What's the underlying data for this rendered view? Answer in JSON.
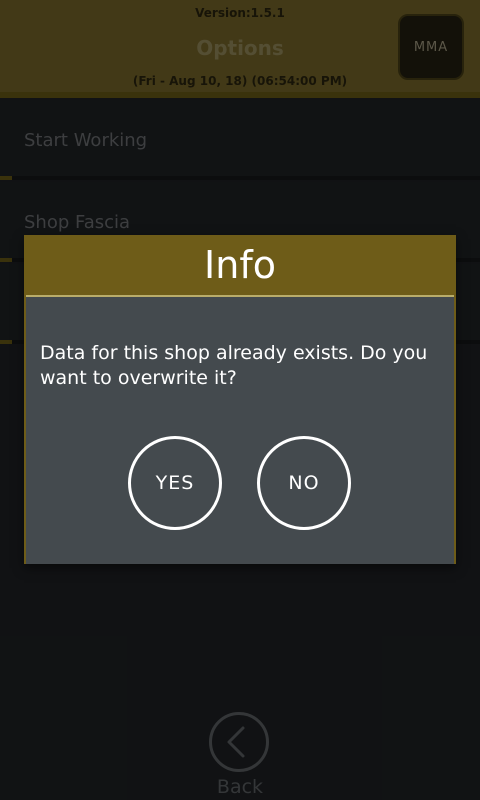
{
  "header": {
    "version": "Version:1.5.1",
    "title": "Options",
    "datetime": "(Fri - Aug 10, 18) (06:54:00 PM)",
    "logo_text": "MMA"
  },
  "menu": {
    "items": [
      {
        "label": "Start Working"
      },
      {
        "label": "Shop Fascia"
      }
    ]
  },
  "dialog": {
    "title": "Info",
    "message": "Data for this shop already exists. Do you want to overwrite it?",
    "yes_label": "YES",
    "no_label": "NO"
  },
  "footer": {
    "back_label": "Back",
    "back_icon": "chevron-left-icon"
  },
  "colors": {
    "accent": "#79682b",
    "dialog_bg": "#444a4e",
    "screen_bg": "#1f2225"
  }
}
